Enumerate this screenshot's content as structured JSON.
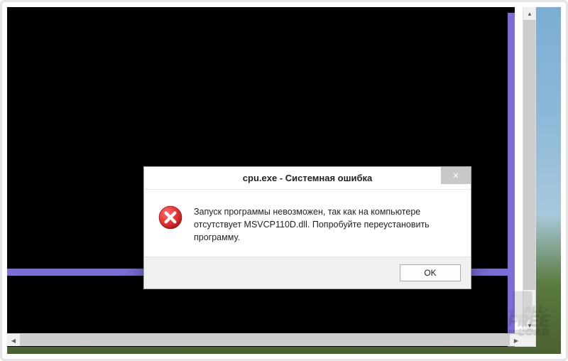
{
  "dialog": {
    "title": "cpu.exe - Системная ошибка",
    "message": "Запуск программы невозможен, так как на компьютере отсутствует MSVCP110D.dll. Попробуйте переустановить программу.",
    "ok_label": "OK",
    "close_symbol": "✕",
    "icon_name": "error-icon"
  },
  "watermark": {
    "line1": "ALL-",
    "line2": "FREE",
    "line3": "LOAD"
  },
  "scrollbar": {
    "up": "▲",
    "down": "▼",
    "left": "◀",
    "right": "▶"
  }
}
